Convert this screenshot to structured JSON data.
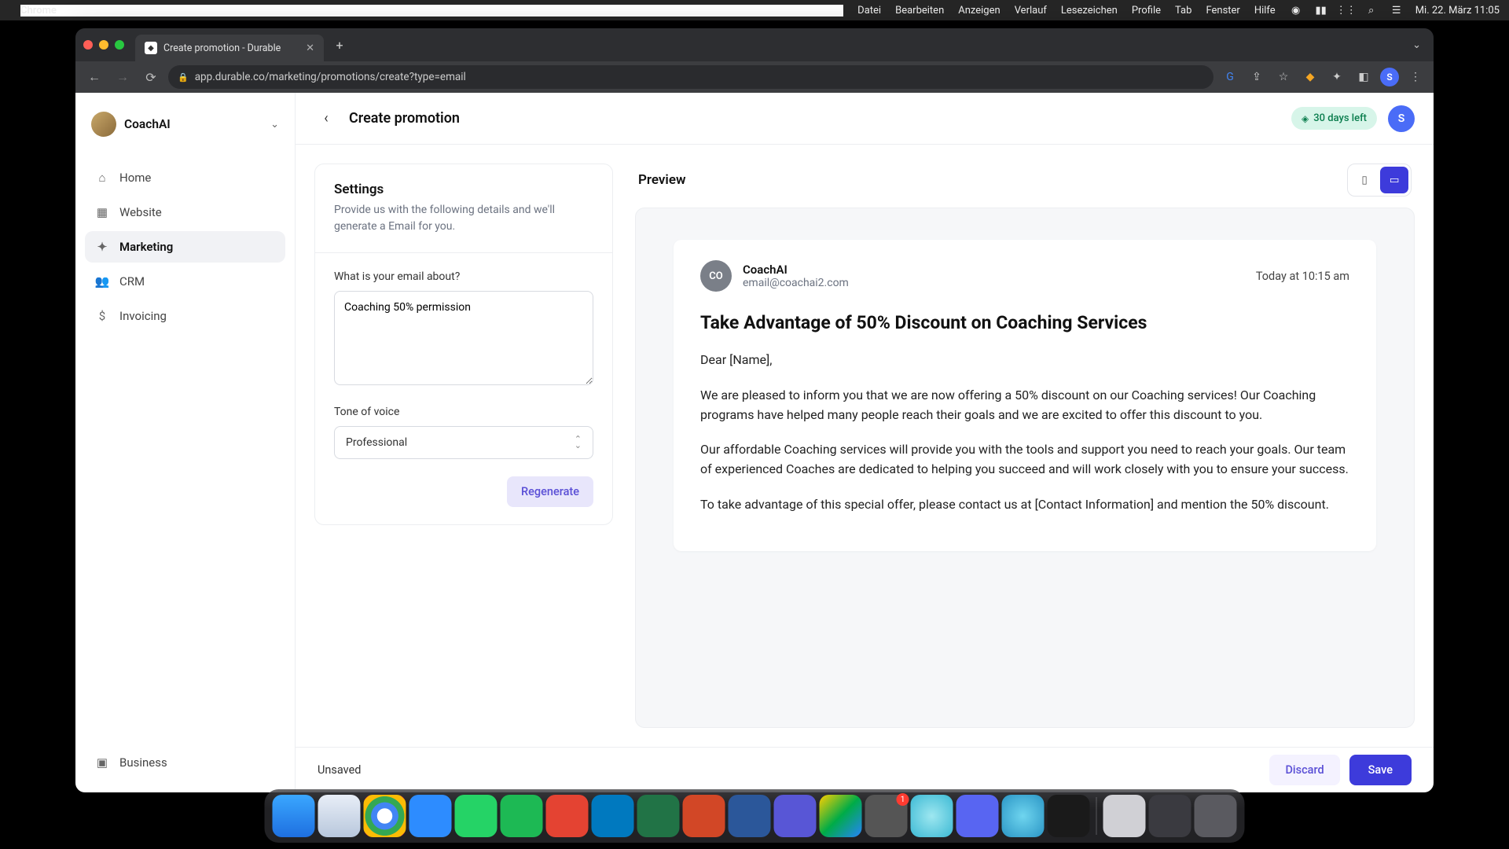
{
  "menubar": {
    "app": "Chrome",
    "items": [
      "Datei",
      "Bearbeiten",
      "Anzeigen",
      "Verlauf",
      "Lesezeichen",
      "Profile",
      "Tab",
      "Fenster",
      "Hilfe"
    ],
    "clock": "Mi. 22. März  11:05"
  },
  "browser": {
    "tab_title": "Create promotion - Durable",
    "url": "app.durable.co/marketing/promotions/create?type=email",
    "profile_initial": "S"
  },
  "sidebar": {
    "workspace": "CoachAI",
    "items": [
      {
        "label": "Home",
        "icon": "⌂"
      },
      {
        "label": "Website",
        "icon": "▦"
      },
      {
        "label": "Marketing",
        "icon": "✦"
      },
      {
        "label": "CRM",
        "icon": "👥"
      },
      {
        "label": "Invoicing",
        "icon": "$"
      }
    ],
    "business": {
      "label": "Business",
      "icon": "▣"
    }
  },
  "header": {
    "title": "Create promotion",
    "badge": "30 days left",
    "avatar": "S"
  },
  "settings": {
    "title": "Settings",
    "subtitle": "Provide us with the following details and we'll generate a Email for you.",
    "about_label": "What is your email about?",
    "about_value": "Coaching 50% permission",
    "tone_label": "Tone of voice",
    "tone_value": "Professional",
    "regenerate": "Regenerate"
  },
  "preview": {
    "title": "Preview",
    "sender_avatar": "CO",
    "sender_name": "CoachAI",
    "sender_email": "email@coachai2.com",
    "timestamp": "Today at 10:15 am",
    "subject": "Take Advantage of 50% Discount on Coaching Services",
    "greeting": "Dear [Name],",
    "p1": "We are pleased to inform you that we are now offering a 50% discount on our Coaching services! Our Coaching programs have helped many people reach their goals and we are excited to offer this discount to you.",
    "p2": "Our affordable Coaching services will provide you with the tools and support you need to reach your goals. Our team of experienced Coaches are dedicated to helping you succeed and will work closely with you to ensure your success.",
    "p3": "To take advantage of this special offer, please contact us at [Contact Information] and mention the 50% discount."
  },
  "footer": {
    "status": "Unsaved",
    "discard": "Discard",
    "save": "Save"
  },
  "dock": {
    "apps": [
      {
        "name": "finder",
        "bg": "linear-gradient(#3aa7ff,#1e6fe0)"
      },
      {
        "name": "safari",
        "bg": "linear-gradient(#e8eef7,#b8c7dc)"
      },
      {
        "name": "chrome",
        "bg": "radial-gradient(circle,#fff 25%,#4285f4 26% 45%,#34a853 46% 65%,#fbbc05 66% 85%,#ea4335 86%)"
      },
      {
        "name": "zoom",
        "bg": "#2d8cff"
      },
      {
        "name": "whatsapp",
        "bg": "#25d366"
      },
      {
        "name": "spotify",
        "bg": "#1db954"
      },
      {
        "name": "todoist",
        "bg": "#e44332"
      },
      {
        "name": "trello",
        "bg": "#0079bf"
      },
      {
        "name": "excel",
        "bg": "#217346"
      },
      {
        "name": "powerpoint",
        "bg": "#d24726"
      },
      {
        "name": "word",
        "bg": "#2b579a"
      },
      {
        "name": "imovie",
        "bg": "#5856d6"
      },
      {
        "name": "drive",
        "bg": "linear-gradient(135deg,#ffcf00,#00ac47,#2684fc)"
      },
      {
        "name": "settings",
        "bg": "#555",
        "badge": "1"
      },
      {
        "name": "app-blue",
        "bg": "radial-gradient(circle,#9ee7f0,#3bb9d4)"
      },
      {
        "name": "discord",
        "bg": "#5865f2"
      },
      {
        "name": "quicktime",
        "bg": "radial-gradient(circle,#6fd5ef,#2a95c5)"
      },
      {
        "name": "audio",
        "bg": "#1a1a1a"
      }
    ],
    "right": [
      {
        "name": "app-gray",
        "bg": "#d0d0d5"
      },
      {
        "name": "launchpad",
        "bg": "#3a3a40"
      },
      {
        "name": "trash",
        "bg": "#5a5a60"
      }
    ]
  }
}
